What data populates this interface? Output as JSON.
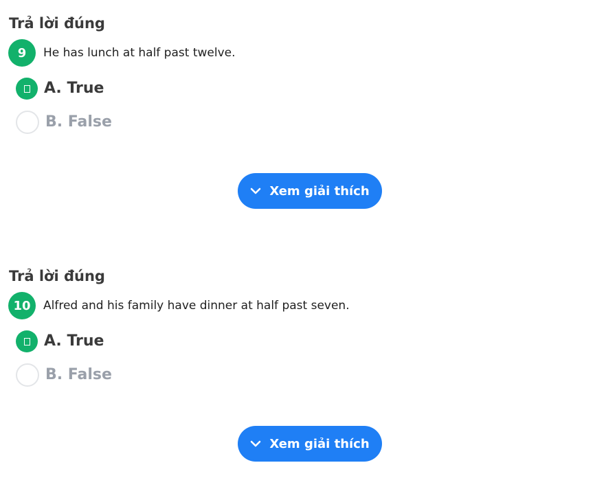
{
  "questions": [
    {
      "status": "Trả lời đúng",
      "number": "9",
      "text": "He has lunch at half past twelve.",
      "options": [
        {
          "label": "A. True",
          "selected": true
        },
        {
          "label": "B. False",
          "selected": false
        }
      ],
      "explain_label": "Xem giải thích"
    },
    {
      "status": "Trả lời đúng",
      "number": "10",
      "text": "Alfred and his family have dinner at half past seven.",
      "options": [
        {
          "label": "A. True",
          "selected": true
        },
        {
          "label": "B. False",
          "selected": false
        }
      ],
      "explain_label": "Xem giải thích"
    }
  ],
  "colors": {
    "correct_green": "#12b16b",
    "button_blue": "#1f7ff5",
    "dim_text": "#9aa0aa"
  },
  "icons": {
    "check": "check-icon",
    "expand": "chevron-down-icon"
  }
}
